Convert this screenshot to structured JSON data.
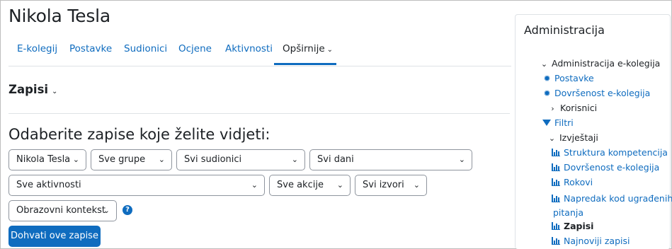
{
  "page": {
    "title": "Nikola Tesla"
  },
  "tabs": [
    {
      "label": "E-kolegij"
    },
    {
      "label": "Postavke"
    },
    {
      "label": "Sudionici"
    },
    {
      "label": "Ocjene"
    },
    {
      "label": "Aktivnosti"
    },
    {
      "label": "Opširnije"
    }
  ],
  "section": {
    "title": "Zapisi"
  },
  "filters": {
    "heading": "Odaberite zapise koje želite vidjeti:",
    "user": "Nikola Tesla",
    "groups": "Sve grupe",
    "participants": "Svi sudionici",
    "days": "Svi dani",
    "activities": "Sve aktivnosti",
    "actions": "Sve akcije",
    "sources": "Svi izvori",
    "context": "Obrazovni kontekst",
    "help": "?",
    "submit": "Dohvati ove zapise"
  },
  "admin": {
    "title": "Administracija",
    "items": [
      {
        "label": "Administracija e-kolegija",
        "icon": "chevron-down-icon"
      },
      {
        "label": "Postavke",
        "icon": "gear-icon"
      },
      {
        "label": "Dovršenost e-kolegija",
        "icon": "gear-icon"
      },
      {
        "label": "Korisnici",
        "icon": "chevron-right-icon"
      },
      {
        "label": "Filtri",
        "icon": "filter-icon"
      },
      {
        "label": "Izvještaji",
        "icon": "chevron-down-icon"
      },
      {
        "label": "Struktura kompetencija",
        "icon": "bar-chart-icon"
      },
      {
        "label": "Dovršenost e-kolegija",
        "icon": "bar-chart-icon"
      },
      {
        "label": "Rokovi",
        "icon": "bar-chart-icon"
      },
      {
        "label": "Napredak kod ugrađenih",
        "label2": "pitanja",
        "icon": "bar-chart-icon"
      },
      {
        "label": "Zapisi",
        "icon": "bar-chart-icon"
      },
      {
        "label": "Najnoviji zapisi",
        "icon": "bar-chart-icon"
      }
    ]
  },
  "colors": {
    "accent": "#0f6cbf",
    "text": "#1d2125",
    "border": "#dee2e6"
  }
}
